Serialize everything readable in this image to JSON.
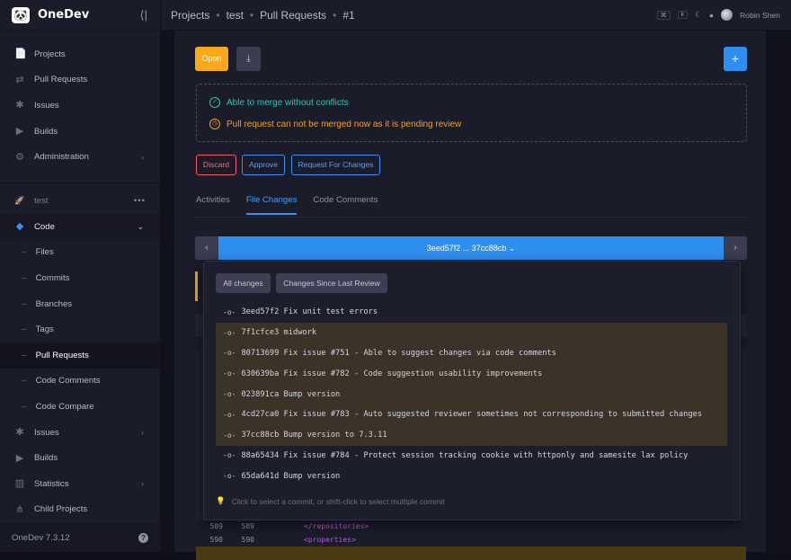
{
  "app": {
    "logo_glyph": "🐼",
    "name": "OneDev",
    "version": "OneDev 7.3.12",
    "help_glyph": "?"
  },
  "nav": {
    "collapse": "⟨|",
    "items": [
      {
        "label": "Projects",
        "icon": "📄"
      },
      {
        "label": "Pull Requests",
        "icon": "⇄"
      },
      {
        "label": "Issues",
        "icon": "✱"
      },
      {
        "label": "Builds",
        "icon": "▶"
      },
      {
        "label": "Administration",
        "icon": "⚙"
      }
    ],
    "project": {
      "name": "test",
      "icon": "🚀",
      "menu": "•••"
    },
    "code": {
      "label": "Code",
      "icon": "◆"
    },
    "code_sub": [
      {
        "label": "Files"
      },
      {
        "label": "Commits"
      },
      {
        "label": "Branches"
      },
      {
        "label": "Tags"
      },
      {
        "label": "Pull Requests"
      },
      {
        "label": "Code Comments"
      },
      {
        "label": "Code Compare"
      }
    ],
    "project_items": [
      {
        "label": "Issues",
        "icon": "✱"
      },
      {
        "label": "Builds",
        "icon": "▶"
      },
      {
        "label": "Statistics",
        "icon": "▥"
      },
      {
        "label": "Child Projects",
        "icon": "⋔"
      }
    ]
  },
  "breadcrumb": {
    "projects": "Projects",
    "project": "test",
    "section": "Pull Requests",
    "id": "#1",
    "sep": "•"
  },
  "topbar": {
    "kbd1": "⌘",
    "kbd2": "k",
    "user": "Robin Shen"
  },
  "pr": {
    "open_label": "Open",
    "download_glyph": "⤓",
    "plus_glyph": "+",
    "merge_ok": "Able to merge without conflicts",
    "merge_warn": "Pull request can not be merged now as it is pending review",
    "actions": {
      "discard": "Discard",
      "approve": "Approve",
      "request": "Request For Changes"
    },
    "tabs": [
      "Activities",
      "File Changes",
      "Code Comments"
    ],
    "range": {
      "label": "3eed57f2 ... 37cc88cb ⌄",
      "prev": "‹",
      "next": "›"
    }
  },
  "dropdown": {
    "all_changes": "All changes",
    "since_review": "Changes Since Last Review",
    "commits": [
      {
        "text": "3eed57f2 Fix unit test errors",
        "selected": false
      },
      {
        "text": "7f1cfce3 midwork",
        "selected": true
      },
      {
        "text": "80713699 Fix issue #751 - Able to suggest changes via code comments",
        "selected": true
      },
      {
        "text": "630639ba Fix issue #782 - Code suggestion usability improvements",
        "selected": true
      },
      {
        "text": "023891ca Bump version",
        "selected": true
      },
      {
        "text": "4cd27ca0 Fix issue #783 - Auto suggested reviewer sometimes not corresponding to submitted changes",
        "selected": true
      },
      {
        "text": "37cc88cb Bump version to 7.3.11",
        "selected": true
      },
      {
        "text": "88a65434 Fix issue #784 - Protect session tracking cookie with httponly and samesite lax policy",
        "selected": false
      },
      {
        "text": "65da641d Bump version",
        "selected": false
      }
    ],
    "commit_icon": "-o-",
    "hint": "Click to select a commit, or shift-click to select multiple commit"
  },
  "code_lines": [
    {
      "old": "589",
      "new": "589",
      "text": "</repositories>"
    },
    {
      "old": "590",
      "new": "590",
      "text": "<properties>"
    }
  ]
}
